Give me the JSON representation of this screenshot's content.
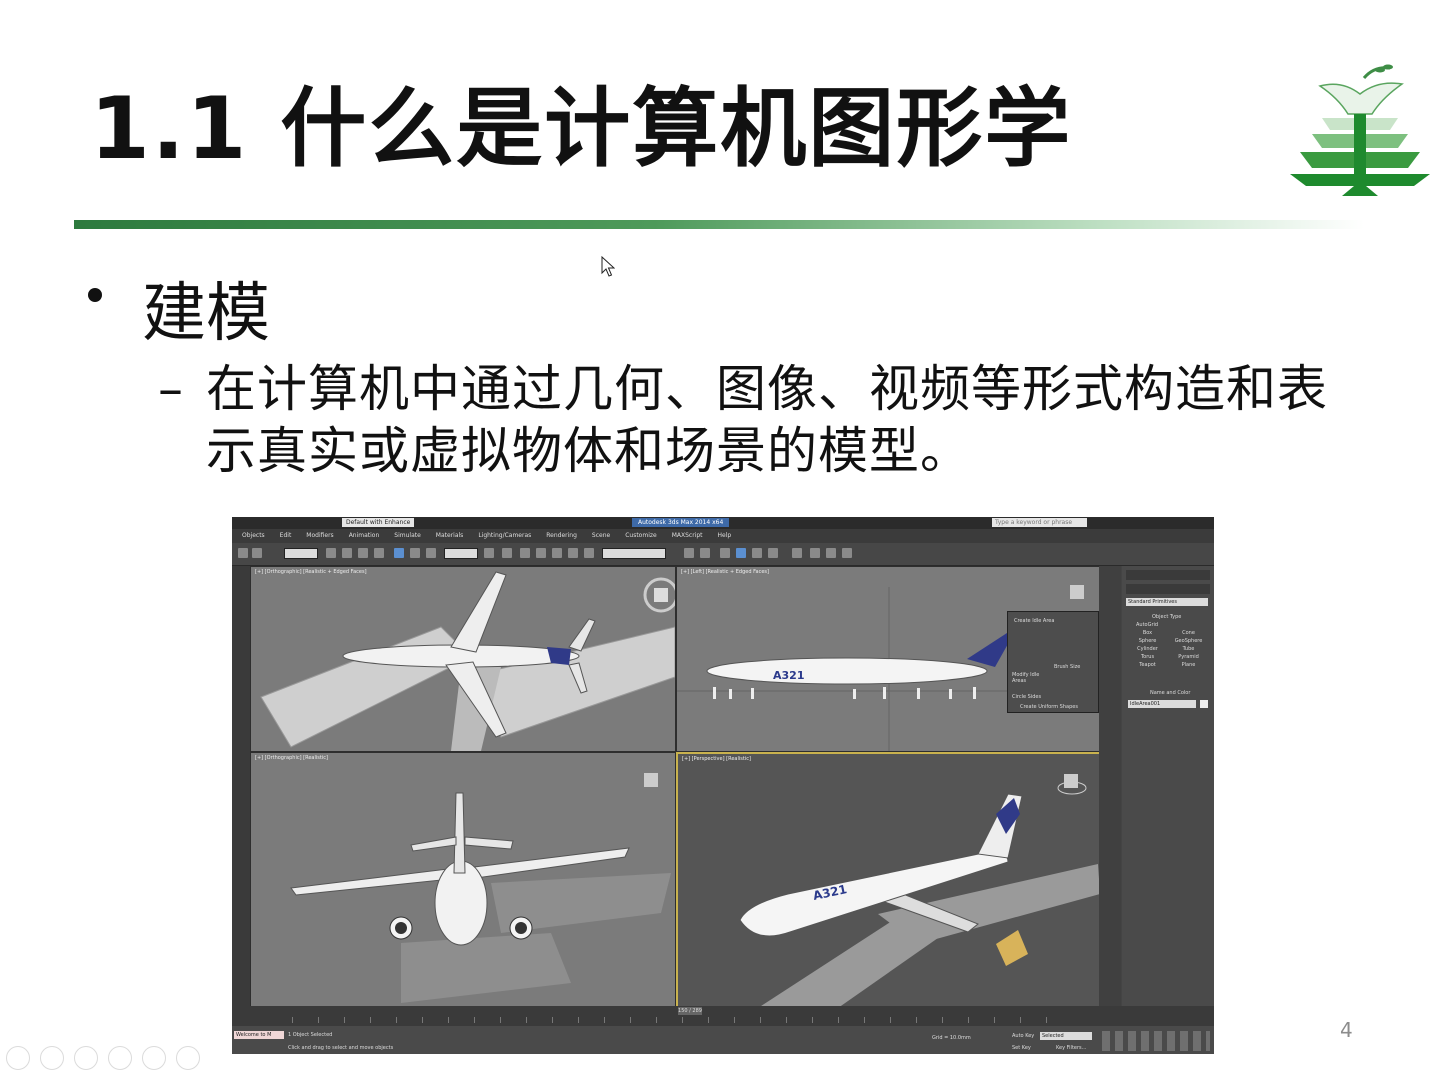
{
  "slide": {
    "title": "1.1 什么是计算机图形学",
    "bullet": "建模",
    "dash": "–",
    "sub_bullet": "在计算机中通过几何、图像、视频等形式构造和表示真实或虚拟物体和场景的模型。",
    "page_number": "4"
  },
  "screenshot": {
    "workspace_dropdown": "Default with Enhance",
    "file_title": "Autodesk 3ds Max 2014 x64",
    "search_placeholder": "Type a keyword or phrase",
    "menus": [
      "Objects",
      "Edit",
      "Modifiers",
      "Animation",
      "Simulate",
      "Materials",
      "Lighting/Cameras",
      "Rendering",
      "Scene",
      "Customize",
      "MAXScript",
      "Help"
    ],
    "viewports": [
      {
        "label": "[+] [Orthographic] [Realistic + Edged Faces]"
      },
      {
        "label": "[+] [Left] [Realistic + Edged Faces]"
      },
      {
        "label": "[+] [Orthographic] [Realistic]"
      },
      {
        "label": "[+] [Perspective] [Realistic]"
      }
    ],
    "aircraft_marking": "A321",
    "idle_panel": {
      "title": "Create Idle Area",
      "brush": "Brush Size",
      "modify": "Modify Idle Areas",
      "circle": "Circle Sides",
      "uniform": "Create Uniform Shapes"
    },
    "command_panel": {
      "dropdown": "Standard Primitives",
      "section_object_type": "Object Type",
      "autogrid": "AutoGrid",
      "primitives": [
        "Box",
        "Cone",
        "Sphere",
        "GeoSphere",
        "Cylinder",
        "Tube",
        "Torus",
        "Pyramid",
        "Teapot",
        "Plane"
      ],
      "section_name": "Name and Color",
      "name_value": "IdleArea001"
    },
    "timeline": "150 / 289",
    "status": {
      "welcome": "Welcome to M",
      "selected": "1 Object Selected",
      "hint": "Click and drag to select and move objects",
      "grid": "Grid = 10.0mm",
      "autokey": "Auto Key",
      "selected_filter": "Selected",
      "setkey": "Set Key",
      "key_filters": "Key Filters..."
    }
  }
}
